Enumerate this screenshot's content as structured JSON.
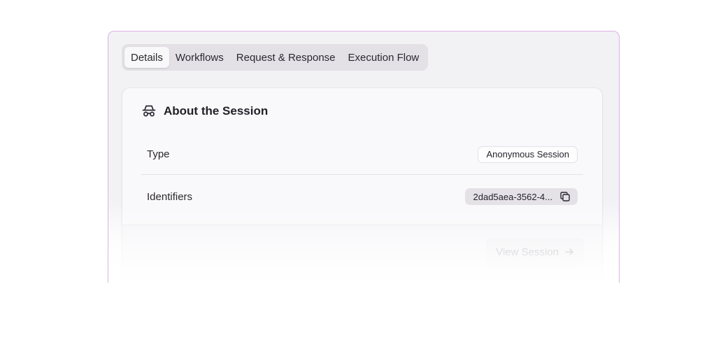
{
  "tabs": [
    {
      "label": "Details",
      "active": true
    },
    {
      "label": "Workflows",
      "active": false
    },
    {
      "label": "Request & Response",
      "active": false
    },
    {
      "label": "Execution Flow",
      "active": false
    }
  ],
  "card": {
    "icon": "incognito-icon",
    "title": "About the Session",
    "rows": [
      {
        "label": "Type",
        "value": "Anonymous Session"
      },
      {
        "label": "Identifiers",
        "value": "2dad5aea-3562-4...",
        "action_icon": "copy-icon"
      }
    ],
    "footer": {
      "button_label": "View Session",
      "button_icon": "arrow-right-icon"
    }
  },
  "colors": {
    "frame_border": "#dcb3e4",
    "tab_bar": "#e3e1e6",
    "card_background": "#f9f8fa",
    "muted_button_text": "#9a97a0"
  }
}
